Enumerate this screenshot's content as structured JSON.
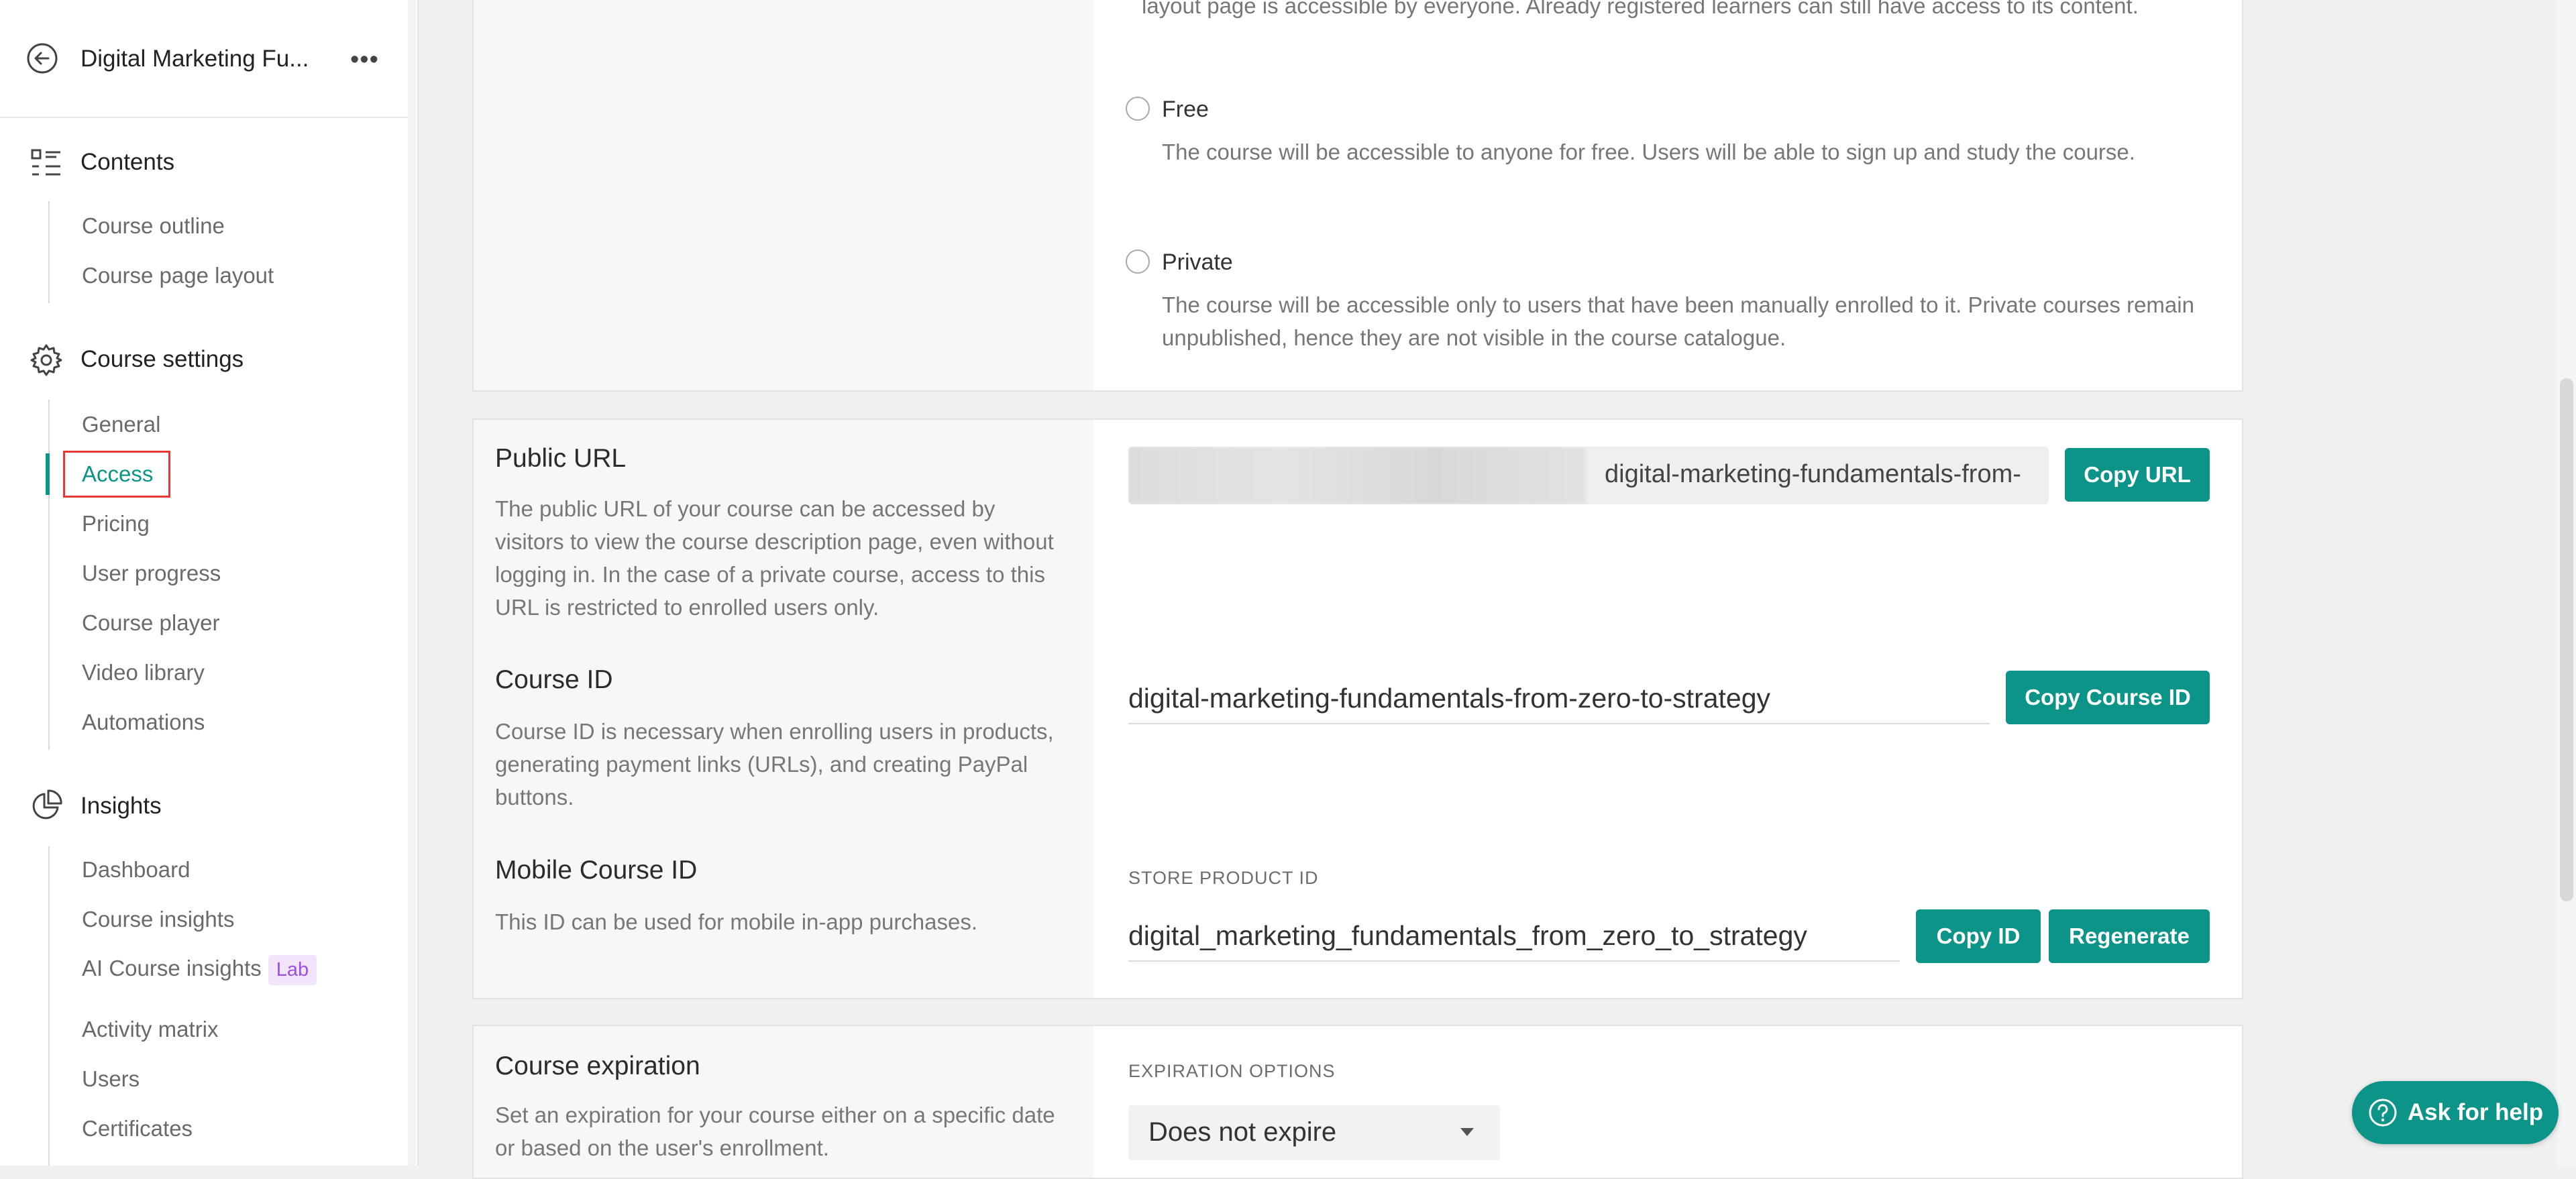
{
  "sidebar": {
    "course_title": "Digital Marketing Fu...",
    "more": "•••",
    "sections": {
      "contents": {
        "label": "Contents",
        "items": [
          "Course outline",
          "Course page layout"
        ]
      },
      "settings": {
        "label": "Course settings",
        "items": [
          "General",
          "Access",
          "Pricing",
          "User progress",
          "Course player",
          "Video library",
          "Automations"
        ]
      },
      "insights": {
        "label": "Insights",
        "items": [
          "Dashboard",
          "Course insights",
          "AI Course insights",
          "Activity matrix",
          "Users",
          "Certificates"
        ],
        "lab_badge": "Lab"
      }
    }
  },
  "access": {
    "top_desc_partial": "layout page is accessible by everyone. Already registered learners can still have access to its content.",
    "free": {
      "label": "Free",
      "desc": "The course will be accessible to anyone for free. Users will be able to sign up and study the course."
    },
    "private": {
      "label": "Private",
      "desc": "The course will be accessible only to users that have been manually enrolled to it. Private courses remain unpublished, hence they are not visible in the course catalogue."
    }
  },
  "public_url": {
    "title": "Public URL",
    "desc": "The public URL of your course can be accessed by visitors to view the course description page, even without logging in. In the case of a private course, access to this URL is restricted to enrolled users only.",
    "slug": "digital-marketing-fundamentals-from-",
    "copy_label": "Copy URL"
  },
  "course_id": {
    "title": "Course ID",
    "desc": "Course ID is necessary when enrolling users in products, generating payment links (URLs), and creating PayPal buttons.",
    "value": "digital-marketing-fundamentals-from-zero-to-strategy",
    "copy_label": "Copy Course ID"
  },
  "mobile_id": {
    "title": "Mobile Course ID",
    "desc": "This ID can be used for mobile in-app purchases.",
    "field_label": "STORE PRODUCT ID",
    "value": "digital_marketing_fundamentals_from_zero_to_strategy",
    "copy_label": "Copy ID",
    "regen_label": "Regenerate"
  },
  "expiration": {
    "title": "Course expiration",
    "desc": "Set an expiration for your course either on a specific date or based on the user's enrollment.",
    "field_label": "EXPIRATION OPTIONS",
    "selected": "Does not expire"
  },
  "help": {
    "label": "Ask for help"
  },
  "colors": {
    "accent": "#0d9488",
    "focus_outline": "#e53935",
    "lab_badge": "#9b51e0"
  }
}
